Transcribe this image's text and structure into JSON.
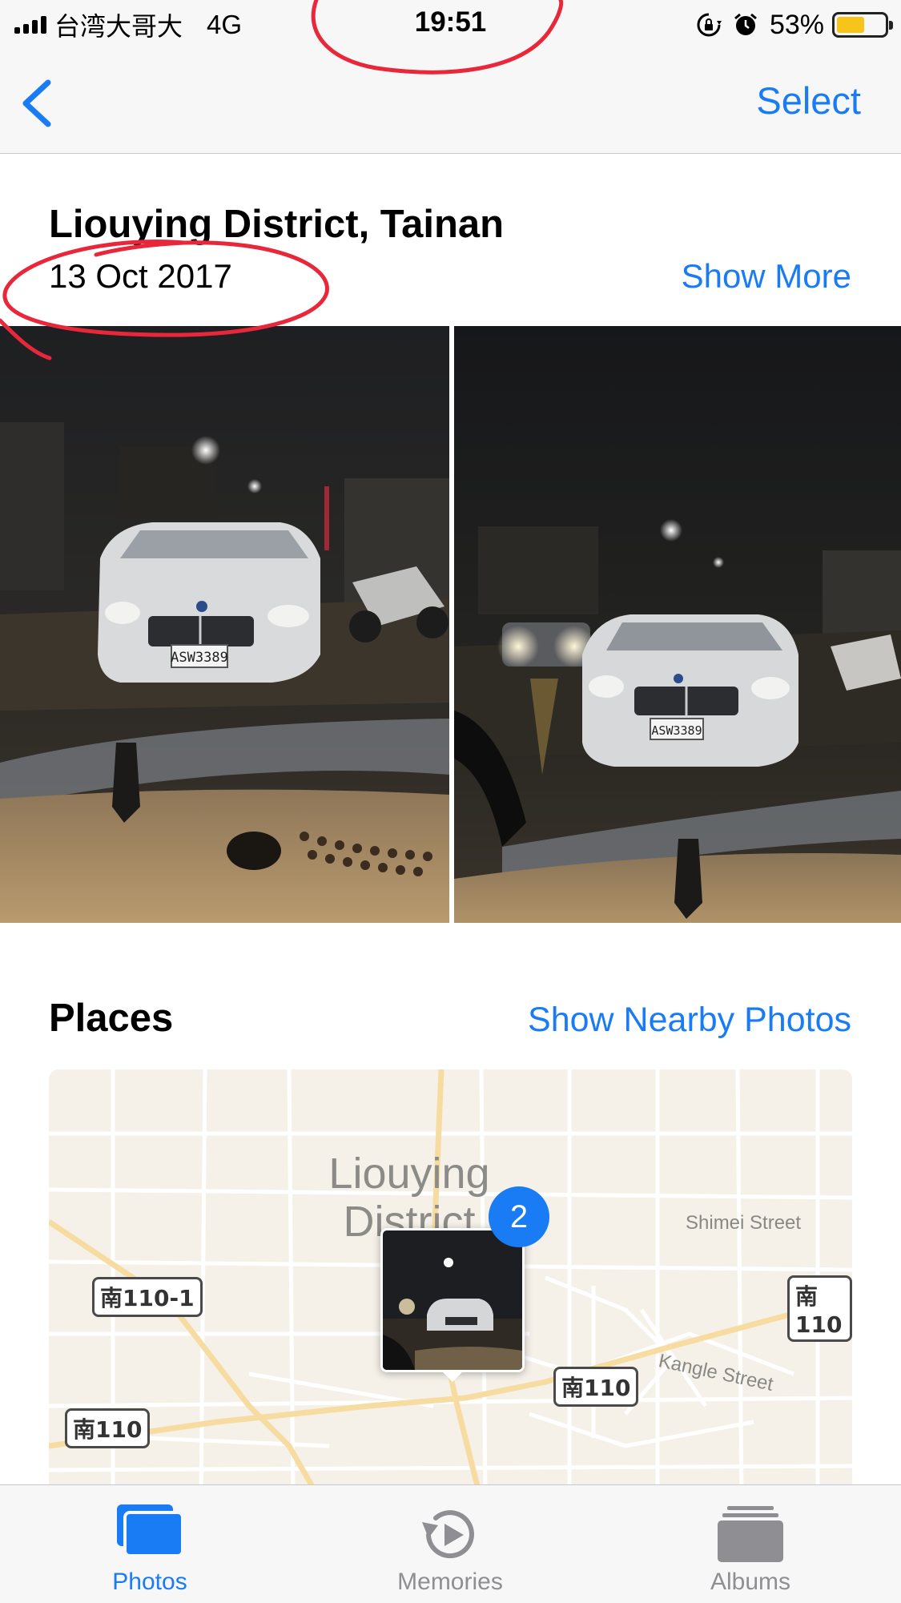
{
  "status_bar": {
    "carrier": "台湾大哥大",
    "network": "4G",
    "time": "19:51",
    "battery_percent": "53%",
    "battery_level": 0.53
  },
  "nav": {
    "back_icon": "chevron-left-icon",
    "select_label": "Select"
  },
  "memory": {
    "title": "Liouying District, Tainan",
    "date": "13 Oct 2017",
    "show_more_label": "Show More",
    "plate_1": "ASW3389",
    "plate_2": "ASW3389"
  },
  "places": {
    "title": "Places",
    "nearby_label": "Show Nearby Photos",
    "map": {
      "area_label": "Liouying District",
      "street_1": "Shimei Street",
      "street_2": "Kangle Street",
      "route_1": "南110-1",
      "route_2": "南110",
      "route_3": "南110",
      "route_4": "南110",
      "photo_count": "2"
    }
  },
  "tabs": [
    {
      "label": "Photos",
      "icon": "photos-icon",
      "active": true
    },
    {
      "label": "Memories",
      "icon": "memories-icon",
      "active": false
    },
    {
      "label": "Albums",
      "icon": "albums-icon",
      "active": false
    }
  ],
  "colors": {
    "accent": "#1a7cf5",
    "annotation": "#e8283a"
  }
}
